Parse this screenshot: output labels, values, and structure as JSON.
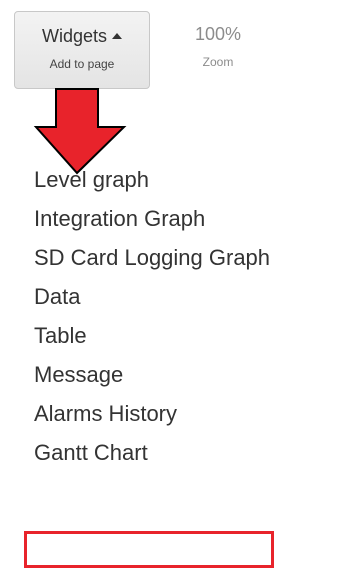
{
  "toolbar": {
    "widgets_label": "Widgets",
    "widgets_sublabel": "Add to page",
    "zoom_value": "100%",
    "zoom_label": "Zoom"
  },
  "menu": {
    "items": [
      {
        "label": "Level graph"
      },
      {
        "label": "Integration Graph"
      },
      {
        "label": "SD Card Logging Graph"
      },
      {
        "label": "Data"
      },
      {
        "label": "Table"
      },
      {
        "label": "Message"
      },
      {
        "label": "Alarms History"
      },
      {
        "label": "Gantt Chart",
        "highlighted": true
      }
    ]
  },
  "colors": {
    "annotation_red": "#e8232b",
    "text": "#333333",
    "muted_text": "#8c8c8c"
  },
  "icons": {
    "widgets_caret": "caret-up-icon",
    "annotation": "down-arrow-icon"
  }
}
